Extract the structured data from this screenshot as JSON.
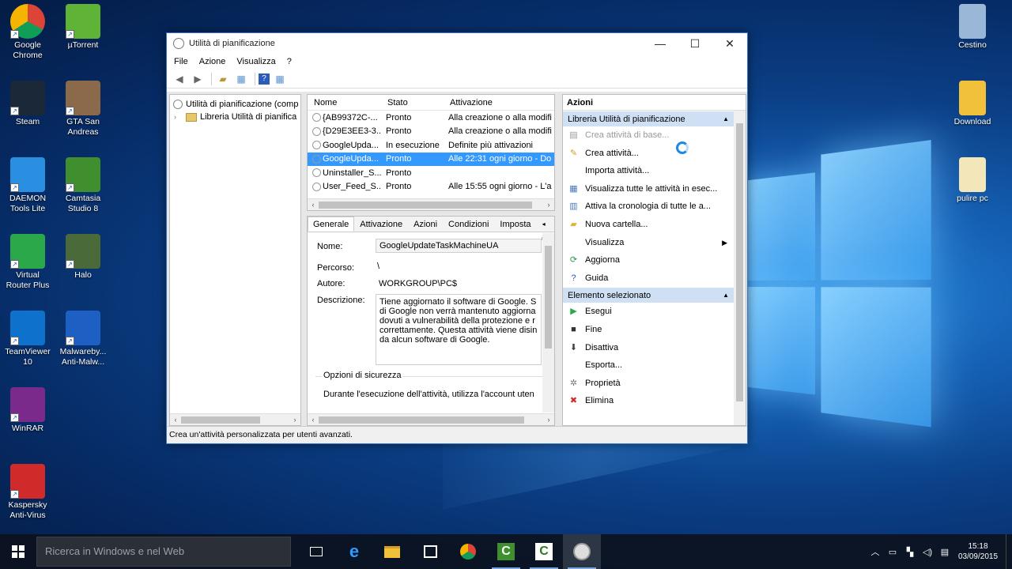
{
  "desktop": {
    "icons_left": [
      {
        "label": "Google\nChrome",
        "icon": "chrome-icon"
      },
      {
        "label": "µTorrent",
        "icon": "utorrent-icon"
      },
      {
        "label": "Steam",
        "icon": "steam-icon"
      },
      {
        "label": "GTA San\nAndreas",
        "icon": "gta-icon"
      },
      {
        "label": "DAEMON\nTools Lite",
        "icon": "daemon-tools-icon"
      },
      {
        "label": "Camtasia\nStudio 8",
        "icon": "camtasia-icon"
      },
      {
        "label": "Virtual\nRouter Plus",
        "icon": "virtual-router-icon"
      },
      {
        "label": "Halo",
        "icon": "halo-icon"
      },
      {
        "label": "TeamViewer\n10",
        "icon": "teamviewer-icon"
      },
      {
        "label": "Malwareby...\nAnti-Malw...",
        "icon": "malwarebytes-icon"
      },
      {
        "label": "WinRAR",
        "icon": "winrar-icon"
      },
      {
        "label": "Kaspersky\nAnti-Virus",
        "icon": "kaspersky-icon"
      }
    ],
    "icons_right": [
      {
        "label": "Cestino",
        "icon": "recycle-bin-icon"
      },
      {
        "label": "Download",
        "icon": "download-folder-icon"
      },
      {
        "label": "pulire pc",
        "icon": "file-icon"
      }
    ]
  },
  "window": {
    "title": "Utilità di pianificazione",
    "menu": [
      "File",
      "Azione",
      "Visualizza",
      "?"
    ],
    "tree": {
      "root": "Utilità di pianificazione (comp",
      "child": "Libreria Utilità di pianifica"
    },
    "task_columns": [
      "Nome",
      "Stato",
      "Attivazione"
    ],
    "tasks": [
      {
        "name": "{AB99372C-...",
        "status": "Pronto",
        "trigger": "Alla creazione o alla modifi"
      },
      {
        "name": "{D29E3EE3-3...",
        "status": "Pronto",
        "trigger": "Alla creazione o alla modifi"
      },
      {
        "name": "GoogleUpda...",
        "status": "In esecuzione",
        "trigger": "Definite più attivazioni"
      },
      {
        "name": "GoogleUpda...",
        "status": "Pronto",
        "trigger": "Alle 22:31 ogni giorno - Do"
      },
      {
        "name": "Uninstaller_S...",
        "status": "Pronto",
        "trigger": ""
      },
      {
        "name": "User_Feed_S...",
        "status": "Pronto",
        "trigger": "Alle 15:55 ogni giorno - L'a"
      }
    ],
    "tabs": [
      "Generale",
      "Attivazione",
      "Azioni",
      "Condizioni",
      "Imposta"
    ],
    "general": {
      "name_label": "Nome:",
      "name_value": "GoogleUpdateTaskMachineUA",
      "path_label": "Percorso:",
      "path_value": "\\",
      "author_label": "Autore:",
      "author_value": "WORKGROUP\\PC$",
      "desc_label": "Descrizione:",
      "desc_value": "Tiene aggiornato il software di Google. S\ndi Google non verrà mantenuto aggiorna\ndovuti a vulnerabilità della protezione e r\ncorrettamente. Questa attività viene disin\nda alcun software di Google.",
      "security_label": "Opzioni di sicurezza",
      "security_text": "Durante l'esecuzione dell'attività, utilizza l'account uten"
    },
    "actions": {
      "title": "Azioni",
      "section1": "Libreria Utilità di pianificazione",
      "section1_items": [
        {
          "label": "Crea attività di base...",
          "icon": "create-basic-task-icon",
          "dim": true
        },
        {
          "label": "Crea attività...",
          "icon": "create-task-icon"
        },
        {
          "label": "Importa attività...",
          "icon": ""
        },
        {
          "label": "Visualizza tutte le attività in esec...",
          "icon": "view-running-icon"
        },
        {
          "label": "Attiva la cronologia di tutte le a...",
          "icon": "history-icon"
        },
        {
          "label": "Nuova cartella...",
          "icon": "folder-icon"
        },
        {
          "label": "Visualizza",
          "icon": "",
          "submenu": true
        },
        {
          "label": "Aggiorna",
          "icon": "refresh-icon"
        },
        {
          "label": "Guida",
          "icon": "help-icon"
        }
      ],
      "section2": "Elemento selezionato",
      "section2_items": [
        {
          "label": "Esegui",
          "icon": "run-icon"
        },
        {
          "label": "Fine",
          "icon": "stop-icon"
        },
        {
          "label": "Disattiva",
          "icon": "disable-icon"
        },
        {
          "label": "Esporta...",
          "icon": ""
        },
        {
          "label": "Proprietà",
          "icon": "properties-icon"
        },
        {
          "label": "Elimina",
          "icon": "delete-icon"
        }
      ]
    },
    "status": "Crea un'attività personalizzata per utenti avanzati."
  },
  "taskbar": {
    "search_placeholder": "Ricerca in Windows e nel Web",
    "time": "15:18",
    "date": "03/09/2015"
  },
  "colors": {
    "selection": "#3399ff",
    "section_header": "#cfe0f5",
    "window_border": "#3a74c4"
  }
}
